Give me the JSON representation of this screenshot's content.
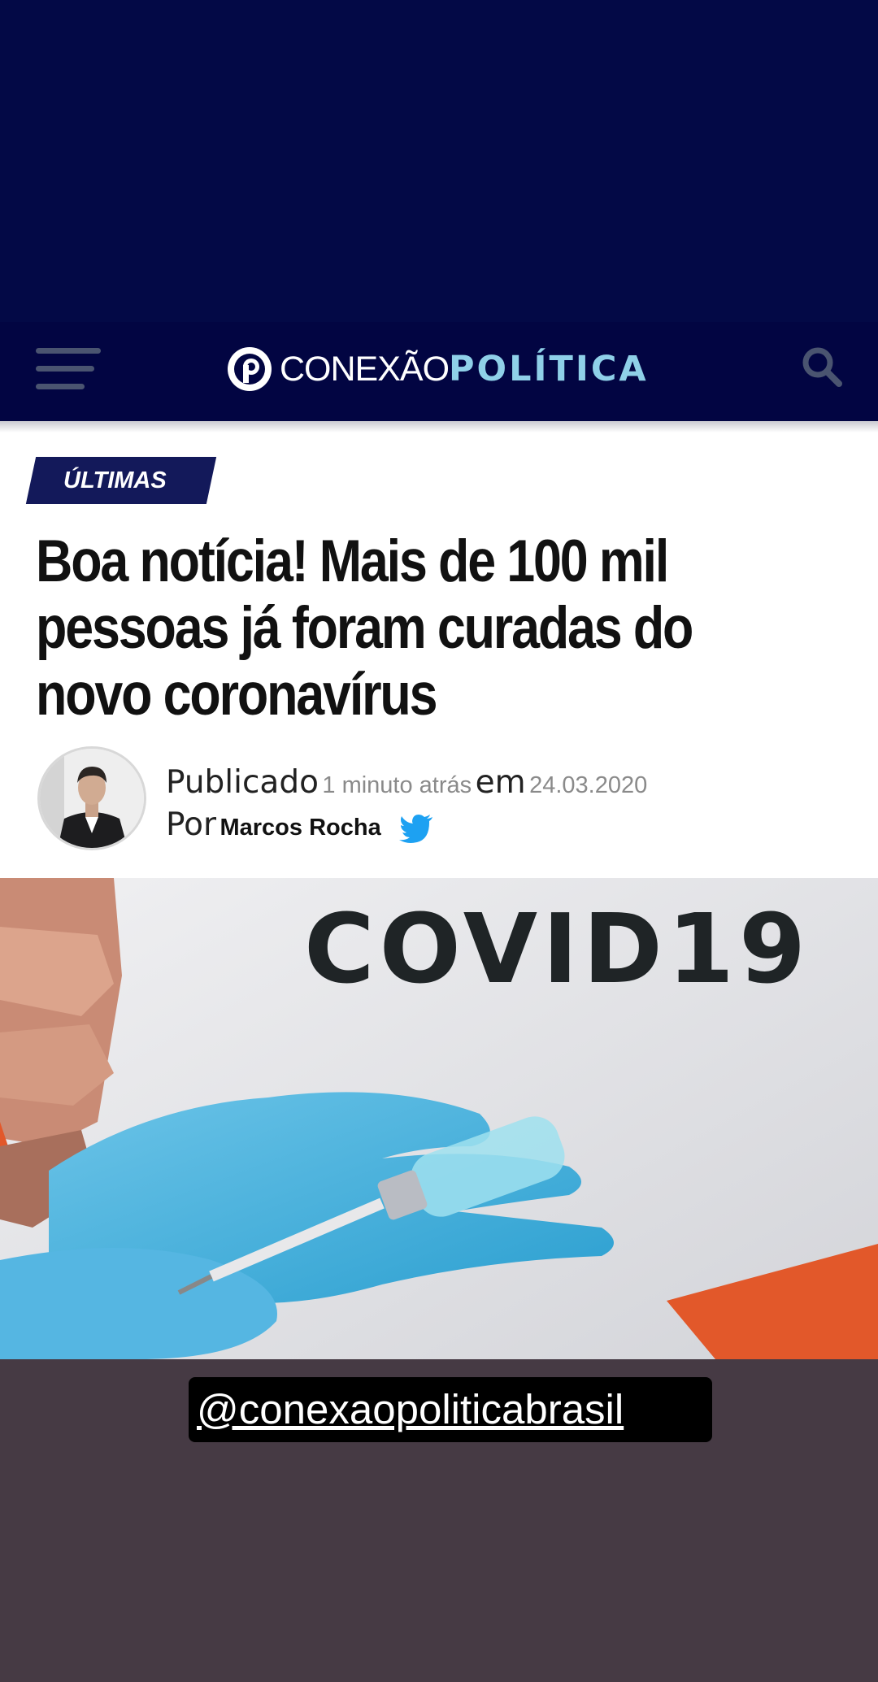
{
  "header": {
    "brand_part1": "CONEXÃO",
    "brand_part2": "POLÍTICA",
    "menu_icon": "hamburger-menu-icon",
    "search_icon": "search-icon",
    "colors": {
      "nav_bg": "#020542",
      "brand_accent": "#8fd0e8"
    }
  },
  "article": {
    "category": "ÚLTIMAS",
    "title": "Boa notícia! Mais de 100 mil pessoas já foram curadas do novo coronavírus",
    "published_label": "Publicado",
    "time_ago": "1 minuto atrás",
    "on_label": "em",
    "date": "24.03.2020",
    "by_label": "Por",
    "author": "Marcos Rocha",
    "author_icon": "twitter-icon"
  },
  "photo": {
    "sign_text": "COVID19"
  },
  "story": {
    "mention": "@conexaopoliticabrasil"
  }
}
